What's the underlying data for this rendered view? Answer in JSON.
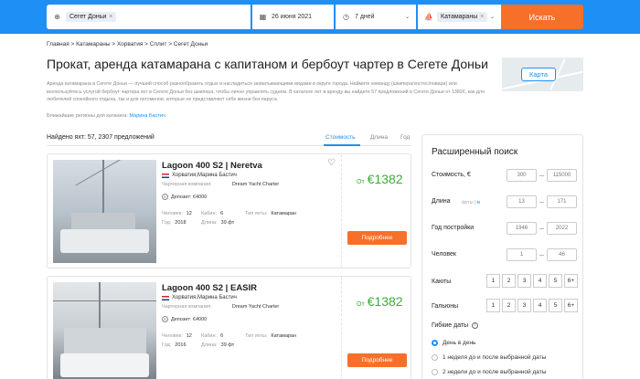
{
  "search": {
    "destination_chip": "Сегет Доньи",
    "date": "26 июня 2021",
    "duration": "7 дней",
    "type_chip": "Катамараны",
    "button": "Искать"
  },
  "breadcrumb": "Главная > Катамараны > Хорватия > Сплит > Сегет Доньи",
  "title": "Прокат, аренда катамарана с капитаном и бербоут чартер в Сегете Доньи",
  "description": "Аренда катамарана в Сегете Доньи — лучший способ разнообразить отдых и насладиться захватывающими видами в округе города. Наймите команду (шкипера/хостес/повара) или воспользуйтесь услугой бербоут чартера яхт в Сегете Доньи без шкипера, чтобы лично управлять судном. В каталоге яхт в аренду вы найдете 57 предложений в Сегете Доньи от 1382€, как для любителей спокойного отдыха, так и для яхтсменов, которые не представляют себе жизни без паруса.",
  "regions_label": "Ближайшие регионы для катанига:",
  "regions_link": "Марина Бастич",
  "map_button": "Карта",
  "results": {
    "found": "Найдено яхт: 57, 2307 предложений",
    "sort": [
      "Стоимость",
      "Длина",
      "Год"
    ]
  },
  "cards": [
    {
      "title": "Lagoon 400 S2 | Neretva",
      "location": "Хорватия,Марина Бастич",
      "company_label": "Чартерная компания:",
      "company": "Dream Yacht Charter",
      "deposit": "Депозит: €4000",
      "people_label": "Человек:",
      "people": "12",
      "cabins_label": "Кабин:",
      "cabins": "6",
      "type_label": "Тип яхты:",
      "type": "Катамаран",
      "year_label": "Год:",
      "year": "2018",
      "length_label": "Длина:",
      "length": "39 фт",
      "price_prefix": "От",
      "price": "€1382",
      "button": "Подробнее"
    },
    {
      "title": "Lagoon 400 S2 | EASIR",
      "location": "Хорватия,Марина Бастич",
      "company_label": "Чартерная компания:",
      "company": "Dream Yacht Charter",
      "deposit": "Депозит: €4000",
      "people_label": "Человек:",
      "people": "12",
      "cabins_label": "Кабин:",
      "cabins": "6",
      "type_label": "Тип яхты:",
      "type": "Катамаран",
      "year_label": "Год:",
      "year": "2016",
      "length_label": "Длина:",
      "length": "39 фт",
      "price_prefix": "От",
      "price": "€1382",
      "button": "Подробнее"
    }
  ],
  "advanced": {
    "title": "Расширенный поиск",
    "price_label": "Стоимость, €",
    "price_min": "300",
    "price_max": "115000",
    "length_label": "Длина",
    "length_unit_ft": "футы",
    "length_unit_m": "м",
    "length_min": "13",
    "length_max": "171",
    "year_label": "Год постройки",
    "year_min": "1946",
    "year_max": "2022",
    "people_label": "Человек",
    "people_min": "1",
    "people_max": "46",
    "cabins_label": "Каюты",
    "heads_label": "Гальюны",
    "counts": [
      "1",
      "2",
      "3",
      "4",
      "5",
      "6+"
    ],
    "flex_title": "Гибкие даты",
    "flex_options": [
      "День в день",
      "1 неделя до и после выбранной даты",
      "2 недели до и после выбранной даты"
    ]
  },
  "colors": {
    "brand_blue": "#1e8ff4",
    "accent_orange": "#f7702a",
    "price_green": "#3cab3a"
  }
}
